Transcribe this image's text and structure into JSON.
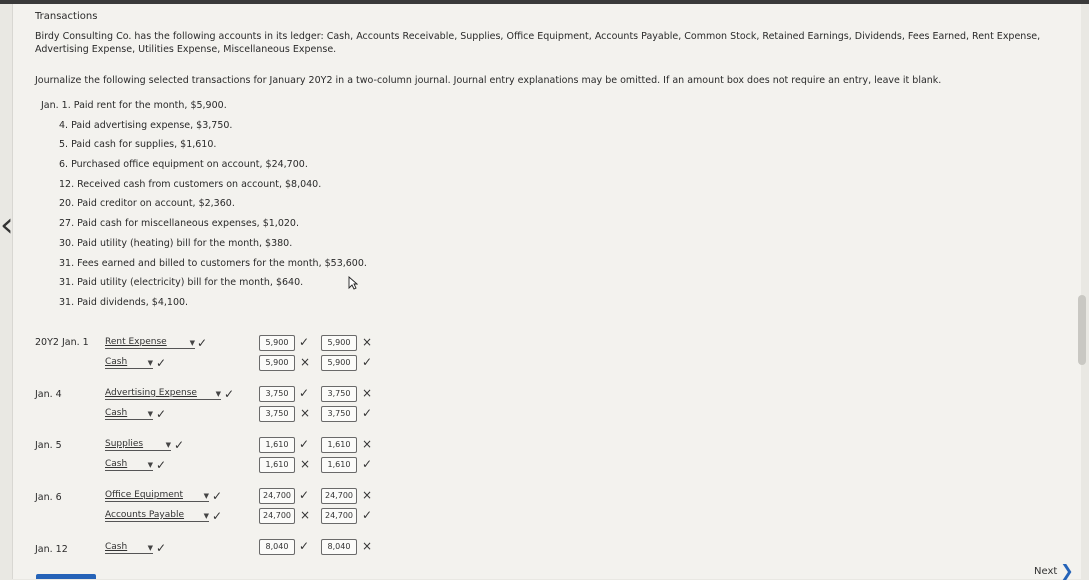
{
  "title": "Transactions",
  "intro": "Birdy Consulting Co. has the following accounts in its ledger: Cash, Accounts Receivable, Supplies, Office Equipment, Accounts Payable, Common Stock, Retained Earnings, Dividends, Fees Earned, Rent Expense, Advertising Expense, Utilities Expense, Miscellaneous Expense.",
  "instructions": "Journalize the following selected transactions for January 20Y2 in a two-column journal. Journal entry explanations may be omitted. If an amount box does not require an entry, leave it blank.",
  "transactions": [
    "Jan. 1. Paid rent for the month, $5,900.",
    "4. Paid advertising expense, $3,750.",
    "5. Paid cash for supplies, $1,610.",
    "6. Purchased office equipment on account, $24,700.",
    "12. Received cash from customers on account, $8,040.",
    "20. Paid creditor on account, $2,360.",
    "27. Paid cash for miscellaneous expenses, $1,020.",
    "30. Paid utility (heating) bill for the month, $380.",
    "31. Fees earned and billed to customers for the month, $53,600.",
    "31. Paid utility (electricity) bill for the month, $640.",
    "31. Paid dividends, $4,100."
  ],
  "marks": {
    "check": "✓",
    "cross": "×"
  },
  "journal": {
    "e1": {
      "date": "20Y2 Jan. 1",
      "r1": {
        "account": "Rent Expense",
        "debit": "5,900",
        "credit": "5,900"
      },
      "r2": {
        "account": "Cash",
        "debit": "5,900",
        "credit": "5,900"
      }
    },
    "e2": {
      "date": "Jan. 4",
      "r1": {
        "account": "Advertising Expense",
        "debit": "3,750",
        "credit": "3,750"
      },
      "r2": {
        "account": "Cash",
        "debit": "3,750",
        "credit": "3,750"
      }
    },
    "e3": {
      "date": "Jan. 5",
      "r1": {
        "account": "Supplies",
        "debit": "1,610",
        "credit": "1,610"
      },
      "r2": {
        "account": "Cash",
        "debit": "1,610",
        "credit": "1,610"
      }
    },
    "e4": {
      "date": "Jan. 6",
      "r1": {
        "account": "Office Equipment",
        "debit": "24,700",
        "credit": "24,700"
      },
      "r2": {
        "account": "Accounts Payable",
        "debit": "24,700",
        "credit": "24,700"
      }
    },
    "e5": {
      "date": "Jan. 12",
      "r1": {
        "account": "Cash",
        "debit": "8,040",
        "credit": "8,040"
      }
    }
  },
  "next_label": "Next",
  "icons": {
    "back": "chevron-left-icon",
    "next": "chevron-right-icon",
    "cursor": "mouse-pointer-icon"
  }
}
